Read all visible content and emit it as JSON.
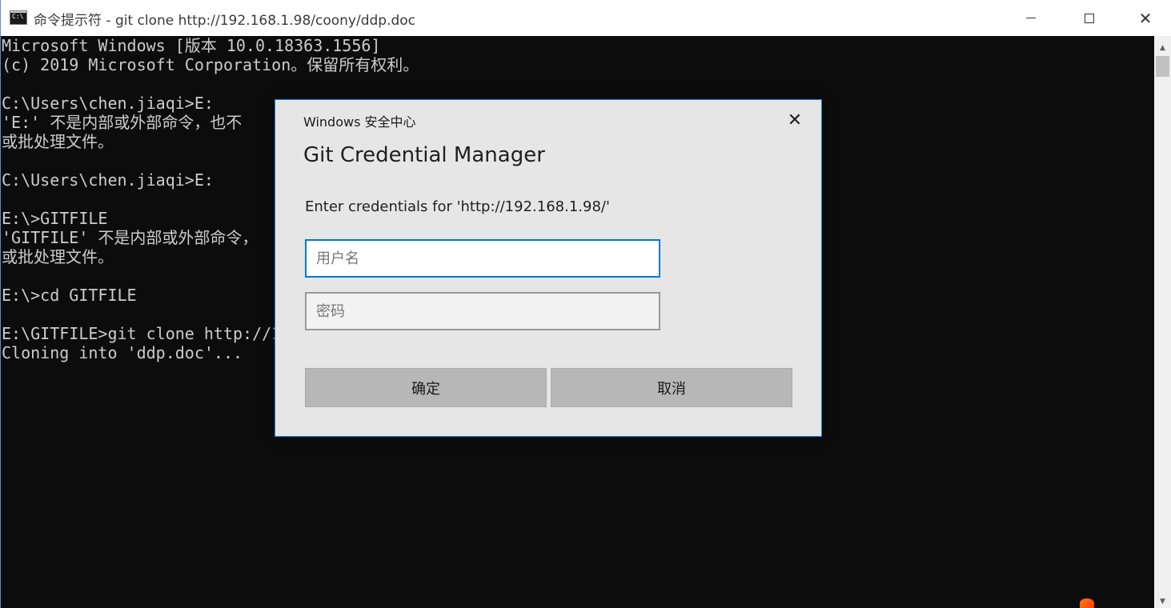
{
  "window": {
    "title": "命令提示符 - git  clone http://192.168.1.98/coony/ddp.doc",
    "icon_label": "C:\\"
  },
  "console": {
    "lines": [
      "Microsoft Windows [版本 10.0.18363.1556]",
      "(c) 2019 Microsoft Corporation。保留所有权利。",
      "",
      "C:\\Users\\chen.jiaqi>E:",
      "'E:' 不是内部或外部命令，也不",
      "或批处理文件。",
      "",
      "C:\\Users\\chen.jiaqi>E:",
      "",
      "E:\\>GITFILE",
      "'GITFILE' 不是内部或外部命令，",
      "或批处理文件。",
      "",
      "E:\\>cd GITFILE",
      "",
      "E:\\GITFILE>git clone http://1",
      "Cloning into 'ddp.doc'..."
    ]
  },
  "dialog": {
    "caption": "Windows 安全中心",
    "title": "Git Credential Manager",
    "prompt": "Enter credentials for 'http://192.168.1.98/'",
    "username_placeholder": "用户名",
    "username_value": "",
    "password_placeholder": "密码",
    "password_value": "",
    "ok_label": "确定",
    "cancel_label": "取消",
    "accent_color": "#0078d7"
  }
}
